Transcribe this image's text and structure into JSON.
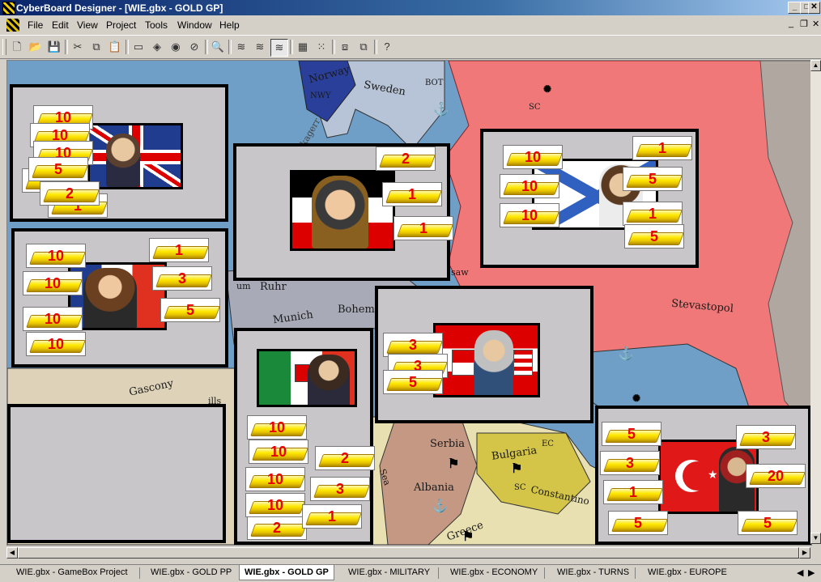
{
  "window": {
    "title": "CyberBoard Designer - [WIE.gbx - GOLD GP]",
    "minimize": "_",
    "maximize": "□",
    "close": "✕",
    "mdi_min": "_",
    "mdi_restore": "❐",
    "mdi_close": "✕"
  },
  "menu": [
    "File",
    "Edit",
    "View",
    "Project",
    "Tools",
    "Window",
    "Help"
  ],
  "toolbar": {
    "icons": [
      "new-icon",
      "open-icon",
      "save-icon",
      "cut-icon",
      "copy-icon",
      "paste-icon",
      "board-icon",
      "tile-icon",
      "marker-icon",
      "zoom-icon",
      "find-icon",
      "layer1-icon",
      "layer2-icon",
      "layer3-icon",
      "grid-icon",
      "dotgrid-icon",
      "group-icon",
      "ungroup-icon",
      "help-icon"
    ]
  },
  "map_labels": {
    "norway": "Norway",
    "nwy": "NWY",
    "sweden": "Sweden",
    "bot": "BOT",
    "sc1": "SC",
    "stevastopol": "Stevastopol",
    "ruhr": "Ruhr",
    "munich": "Munich",
    "bohem": "Bohem",
    "gascony": "Gascony",
    "serbia": "Serbia",
    "bulgaria": "Bulgaria",
    "ec": "EC",
    "albania": "Albania",
    "sc2": "SC",
    "constantino": "Constantino",
    "greece": "Greece",
    "sea": "Sea",
    "skagerr": "Skagerr",
    "saw": "saw",
    "um": "um",
    "ills": "ills"
  },
  "panels": {
    "britain": [
      "10",
      "10",
      "10",
      "5",
      "2",
      "1"
    ],
    "germany": [
      "2",
      "1",
      "1"
    ],
    "russia_left": [
      "10",
      "10",
      "10"
    ],
    "russia_right": [
      "1",
      "5",
      "1",
      "5"
    ],
    "france_left": [
      "10",
      "10",
      "10",
      "10"
    ],
    "france_right": [
      "1",
      "3",
      "5"
    ],
    "austria": [
      "3",
      "3",
      "5"
    ],
    "italy_left": [
      "10",
      "10",
      "10",
      "10",
      "2"
    ],
    "italy_right": [
      "2",
      "3",
      "1"
    ],
    "turkey_left": [
      "5",
      "3",
      "1",
      "5"
    ],
    "turkey_right": [
      "3",
      "20",
      "5"
    ]
  },
  "tabs": [
    "WIE.gbx - GameBox Project",
    "WIE.gbx - GOLD PP",
    "WIE.gbx - GOLD GP",
    "WIE.gbx - MILITARY",
    "WIE.gbx - ECONOMY",
    "WIE.gbx - TURNS",
    "WIE.gbx - EUROPE"
  ],
  "active_tab": "WIE.gbx - GOLD GP",
  "colors": {
    "sea": "#6f9ec6",
    "russia": "#f07878",
    "panel": "#c8c6c8",
    "token_number": "#e80000"
  }
}
